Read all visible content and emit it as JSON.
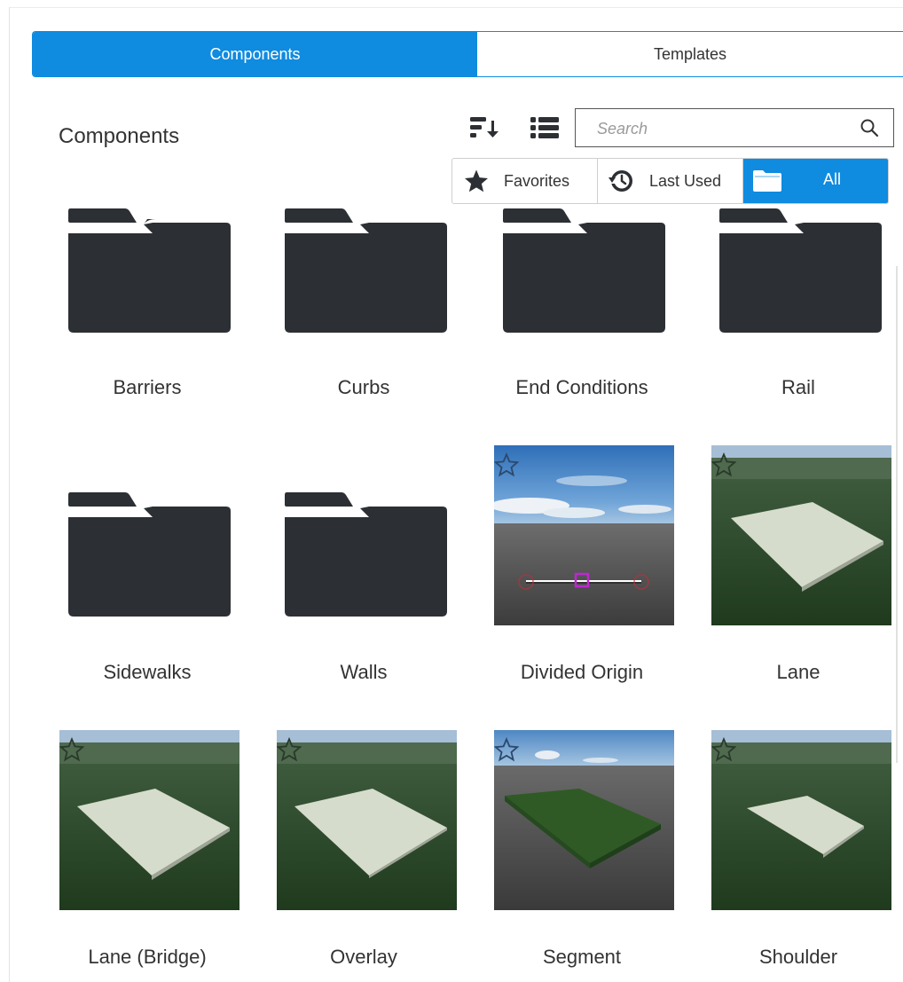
{
  "tabs": [
    {
      "label": "Components",
      "active": true
    },
    {
      "label": "Templates",
      "active": false
    }
  ],
  "section_title": "Components",
  "toolbar": {
    "sort_icon": "sort-icon",
    "list_view_icon": "list-view-icon"
  },
  "search": {
    "placeholder": "Search",
    "value": "",
    "icon": "search-icon"
  },
  "filters": [
    {
      "label": "Favorites",
      "icon": "star-icon",
      "active": false
    },
    {
      "label": "Last Used",
      "icon": "history-icon",
      "active": false
    },
    {
      "label": "All",
      "icon": "folder-icon",
      "active": true
    }
  ],
  "items": [
    {
      "label": "Barriers",
      "kind": "folder"
    },
    {
      "label": "Curbs",
      "kind": "folder"
    },
    {
      "label": "End Conditions",
      "kind": "folder"
    },
    {
      "label": "Rail",
      "kind": "folder"
    },
    {
      "label": "Sidewalks",
      "kind": "folder"
    },
    {
      "label": "Walls",
      "kind": "folder"
    },
    {
      "label": "Divided Origin",
      "kind": "component",
      "thumbnail": "sky-asphalt-origin",
      "favorite": false
    },
    {
      "label": "Lane",
      "kind": "component",
      "thumbnail": "slab-on-grass",
      "favorite": false
    },
    {
      "label": "Lane (Bridge)",
      "kind": "component",
      "thumbnail": "slab-on-grass",
      "favorite": false
    },
    {
      "label": "Overlay",
      "kind": "component",
      "thumbnail": "slab-on-grass",
      "favorite": false
    },
    {
      "label": "Segment",
      "kind": "component",
      "thumbnail": "grass-on-asphalt",
      "favorite": false
    },
    {
      "label": "Shoulder",
      "kind": "component",
      "thumbnail": "slab-on-grass",
      "favorite": false
    }
  ],
  "colors": {
    "accent": "#0f8be0",
    "folder": "#2c2f33",
    "text": "#333333"
  }
}
